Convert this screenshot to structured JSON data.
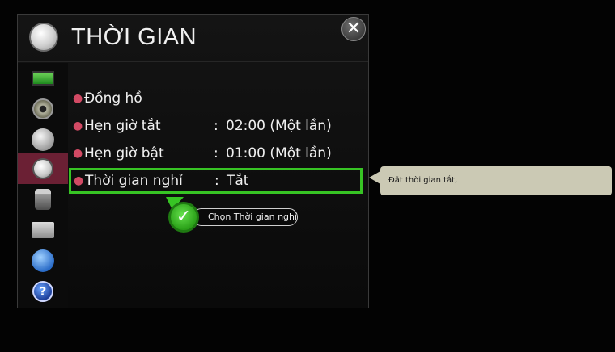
{
  "window": {
    "title": "THỜI GIAN",
    "close_icon": "close-icon"
  },
  "sidebar": {
    "items": [
      {
        "name": "picture-icon",
        "active": false
      },
      {
        "name": "sound-icon",
        "active": false
      },
      {
        "name": "channel-icon",
        "active": false
      },
      {
        "name": "time-icon",
        "active": true
      },
      {
        "name": "lock-icon",
        "active": false
      },
      {
        "name": "option-icon",
        "active": false
      },
      {
        "name": "network-icon",
        "active": false
      },
      {
        "name": "support-icon",
        "active": false,
        "glyph": "?"
      }
    ]
  },
  "menu": {
    "items": [
      {
        "label": "Đồng hồ",
        "value": ""
      },
      {
        "label": "Hẹn giờ tắt",
        "value": "02:00 (Một lần)"
      },
      {
        "label": "Hẹn giờ bật",
        "value": "01:00 (Một lần)"
      },
      {
        "label": "Thời gian nghỉ",
        "value": "Tắt"
      }
    ],
    "selected_index": 3
  },
  "hint": {
    "text": "Chọn Thời gian nghỉ"
  },
  "tooltip": {
    "text": "Đặt thời gian tắt,"
  },
  "colors": {
    "accent_selected": "#37c424",
    "sidebar_active": "#6b2034",
    "bullet": "#d24a64",
    "tooltip_bg": "#cbc9b4"
  }
}
